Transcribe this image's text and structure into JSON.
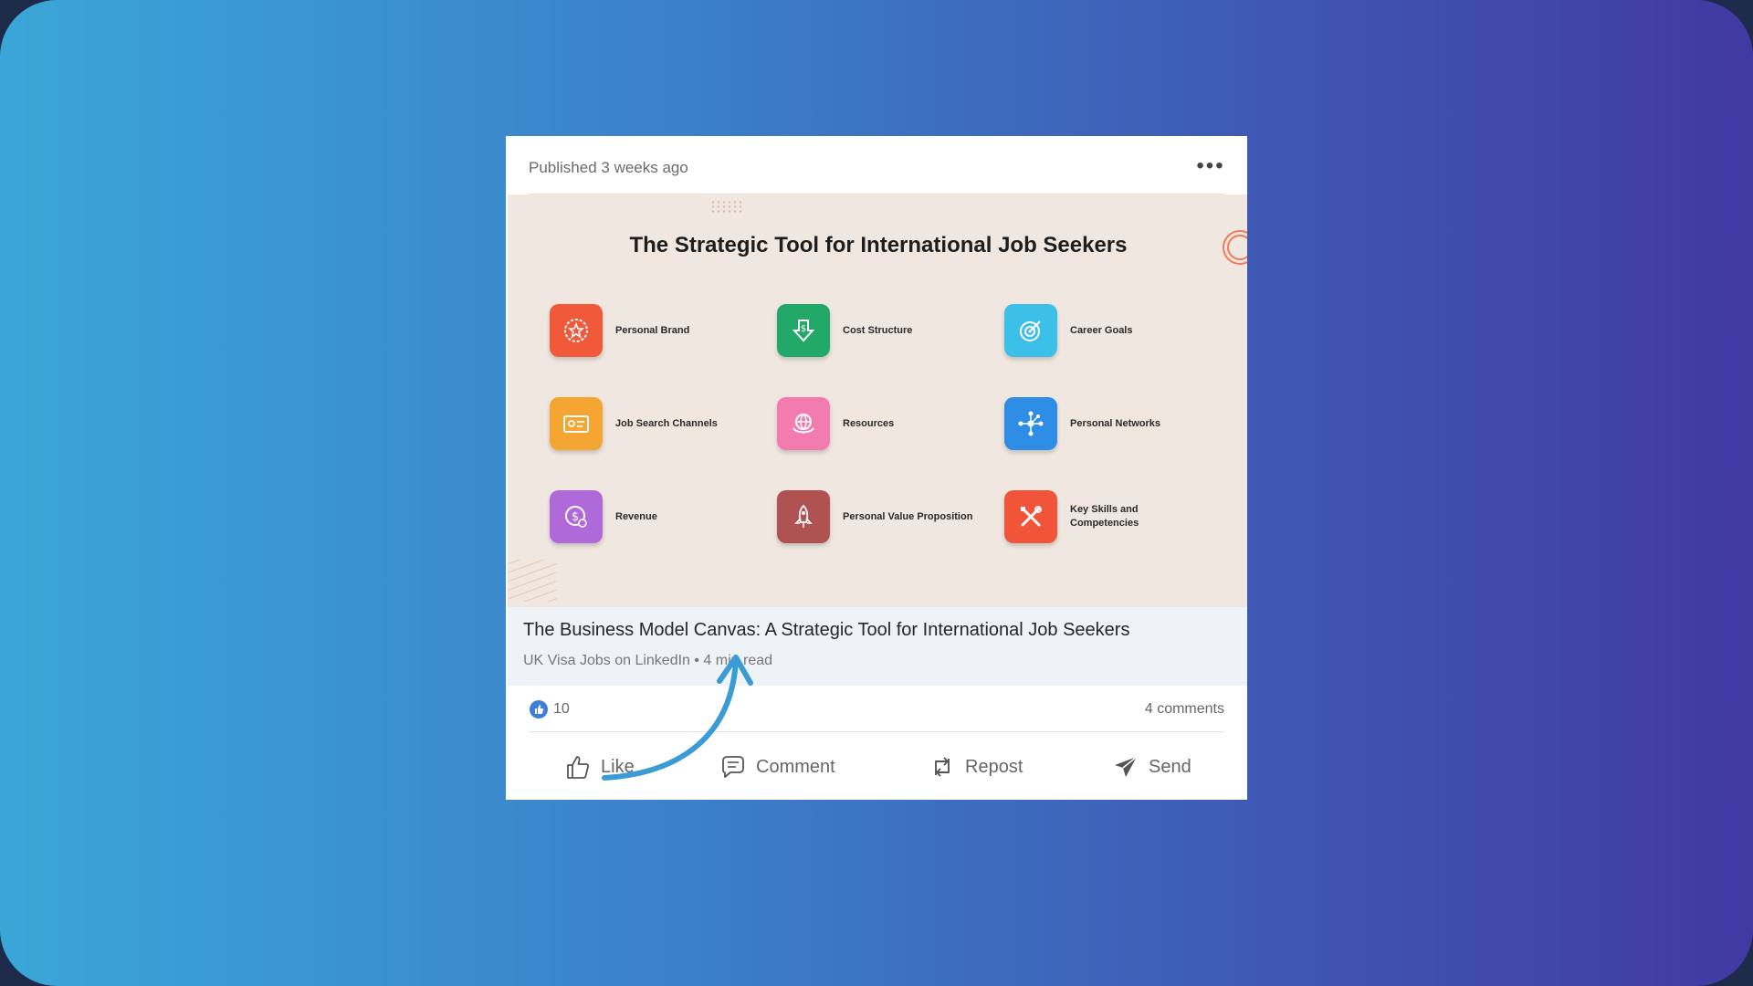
{
  "post": {
    "published": "Published 3 weeks ago",
    "more_icon": "more-horizontal-icon"
  },
  "image": {
    "title": "The Strategic Tool for International Job Seekers",
    "tiles": [
      {
        "label": "Personal Brand",
        "icon": "star-badge-icon",
        "color": "#f0593a"
      },
      {
        "label": "Cost Structure",
        "icon": "dollar-down-arrow-icon",
        "color": "#22a96a"
      },
      {
        "label": "Career Goals",
        "icon": "target-icon",
        "color": "#3cbfe8"
      },
      {
        "label": "Job Search Channels",
        "icon": "id-card-icon",
        "color": "#f5a531"
      },
      {
        "label": "Resources",
        "icon": "globe-hands-icon",
        "color": "#f27bb0"
      },
      {
        "label": "Personal Networks",
        "icon": "network-icon",
        "color": "#2e8ee6"
      },
      {
        "label": "Revenue",
        "icon": "dollar-coin-icon",
        "color": "#b069d8"
      },
      {
        "label": "Personal Value Proposition",
        "icon": "rocket-icon",
        "color": "#b05252"
      },
      {
        "label": "Key Skills and Competencies",
        "icon": "tools-icon",
        "color": "#f0553a"
      }
    ]
  },
  "article": {
    "title": "The Business Model Canvas: A Strategic Tool for International Job Seekers",
    "meta": "UK Visa Jobs on LinkedIn • 4 min read"
  },
  "stats": {
    "likes": "10",
    "comments": "4 comments"
  },
  "actions": {
    "like": "Like",
    "comment": "Comment",
    "repost": "Repost",
    "send": "Send"
  },
  "colors": {
    "arrow": "#3a9bd5",
    "like_bubble": "#3d7fd6"
  }
}
